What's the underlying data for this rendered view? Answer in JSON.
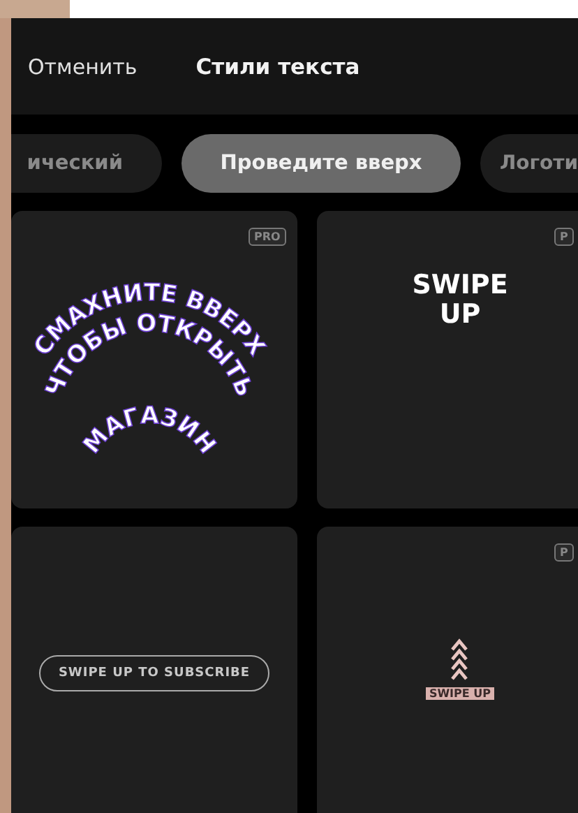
{
  "header": {
    "cancel": "Отменить",
    "title": "Стили текста"
  },
  "tabs": [
    {
      "label": "ический",
      "selected": false
    },
    {
      "label": "Проведите вверх",
      "selected": true
    },
    {
      "label": "Логоти",
      "selected": false
    }
  ],
  "cards": [
    {
      "kind": "arc",
      "badge": "PRO",
      "lines": [
        "СМАХНИТЕ ВВЕРХ",
        "ЧТОБЫ ОТКРЫТЬ",
        "МАГАЗИН"
      ]
    },
    {
      "kind": "bold",
      "badge": "P",
      "lines": [
        "SWIPE",
        "UP"
      ]
    },
    {
      "kind": "pill",
      "lines": [
        "SWIPE UP TO SUBSCRIBE"
      ]
    },
    {
      "kind": "arrows",
      "badge": "P",
      "lines": [
        "SWIPE UP"
      ]
    }
  ]
}
